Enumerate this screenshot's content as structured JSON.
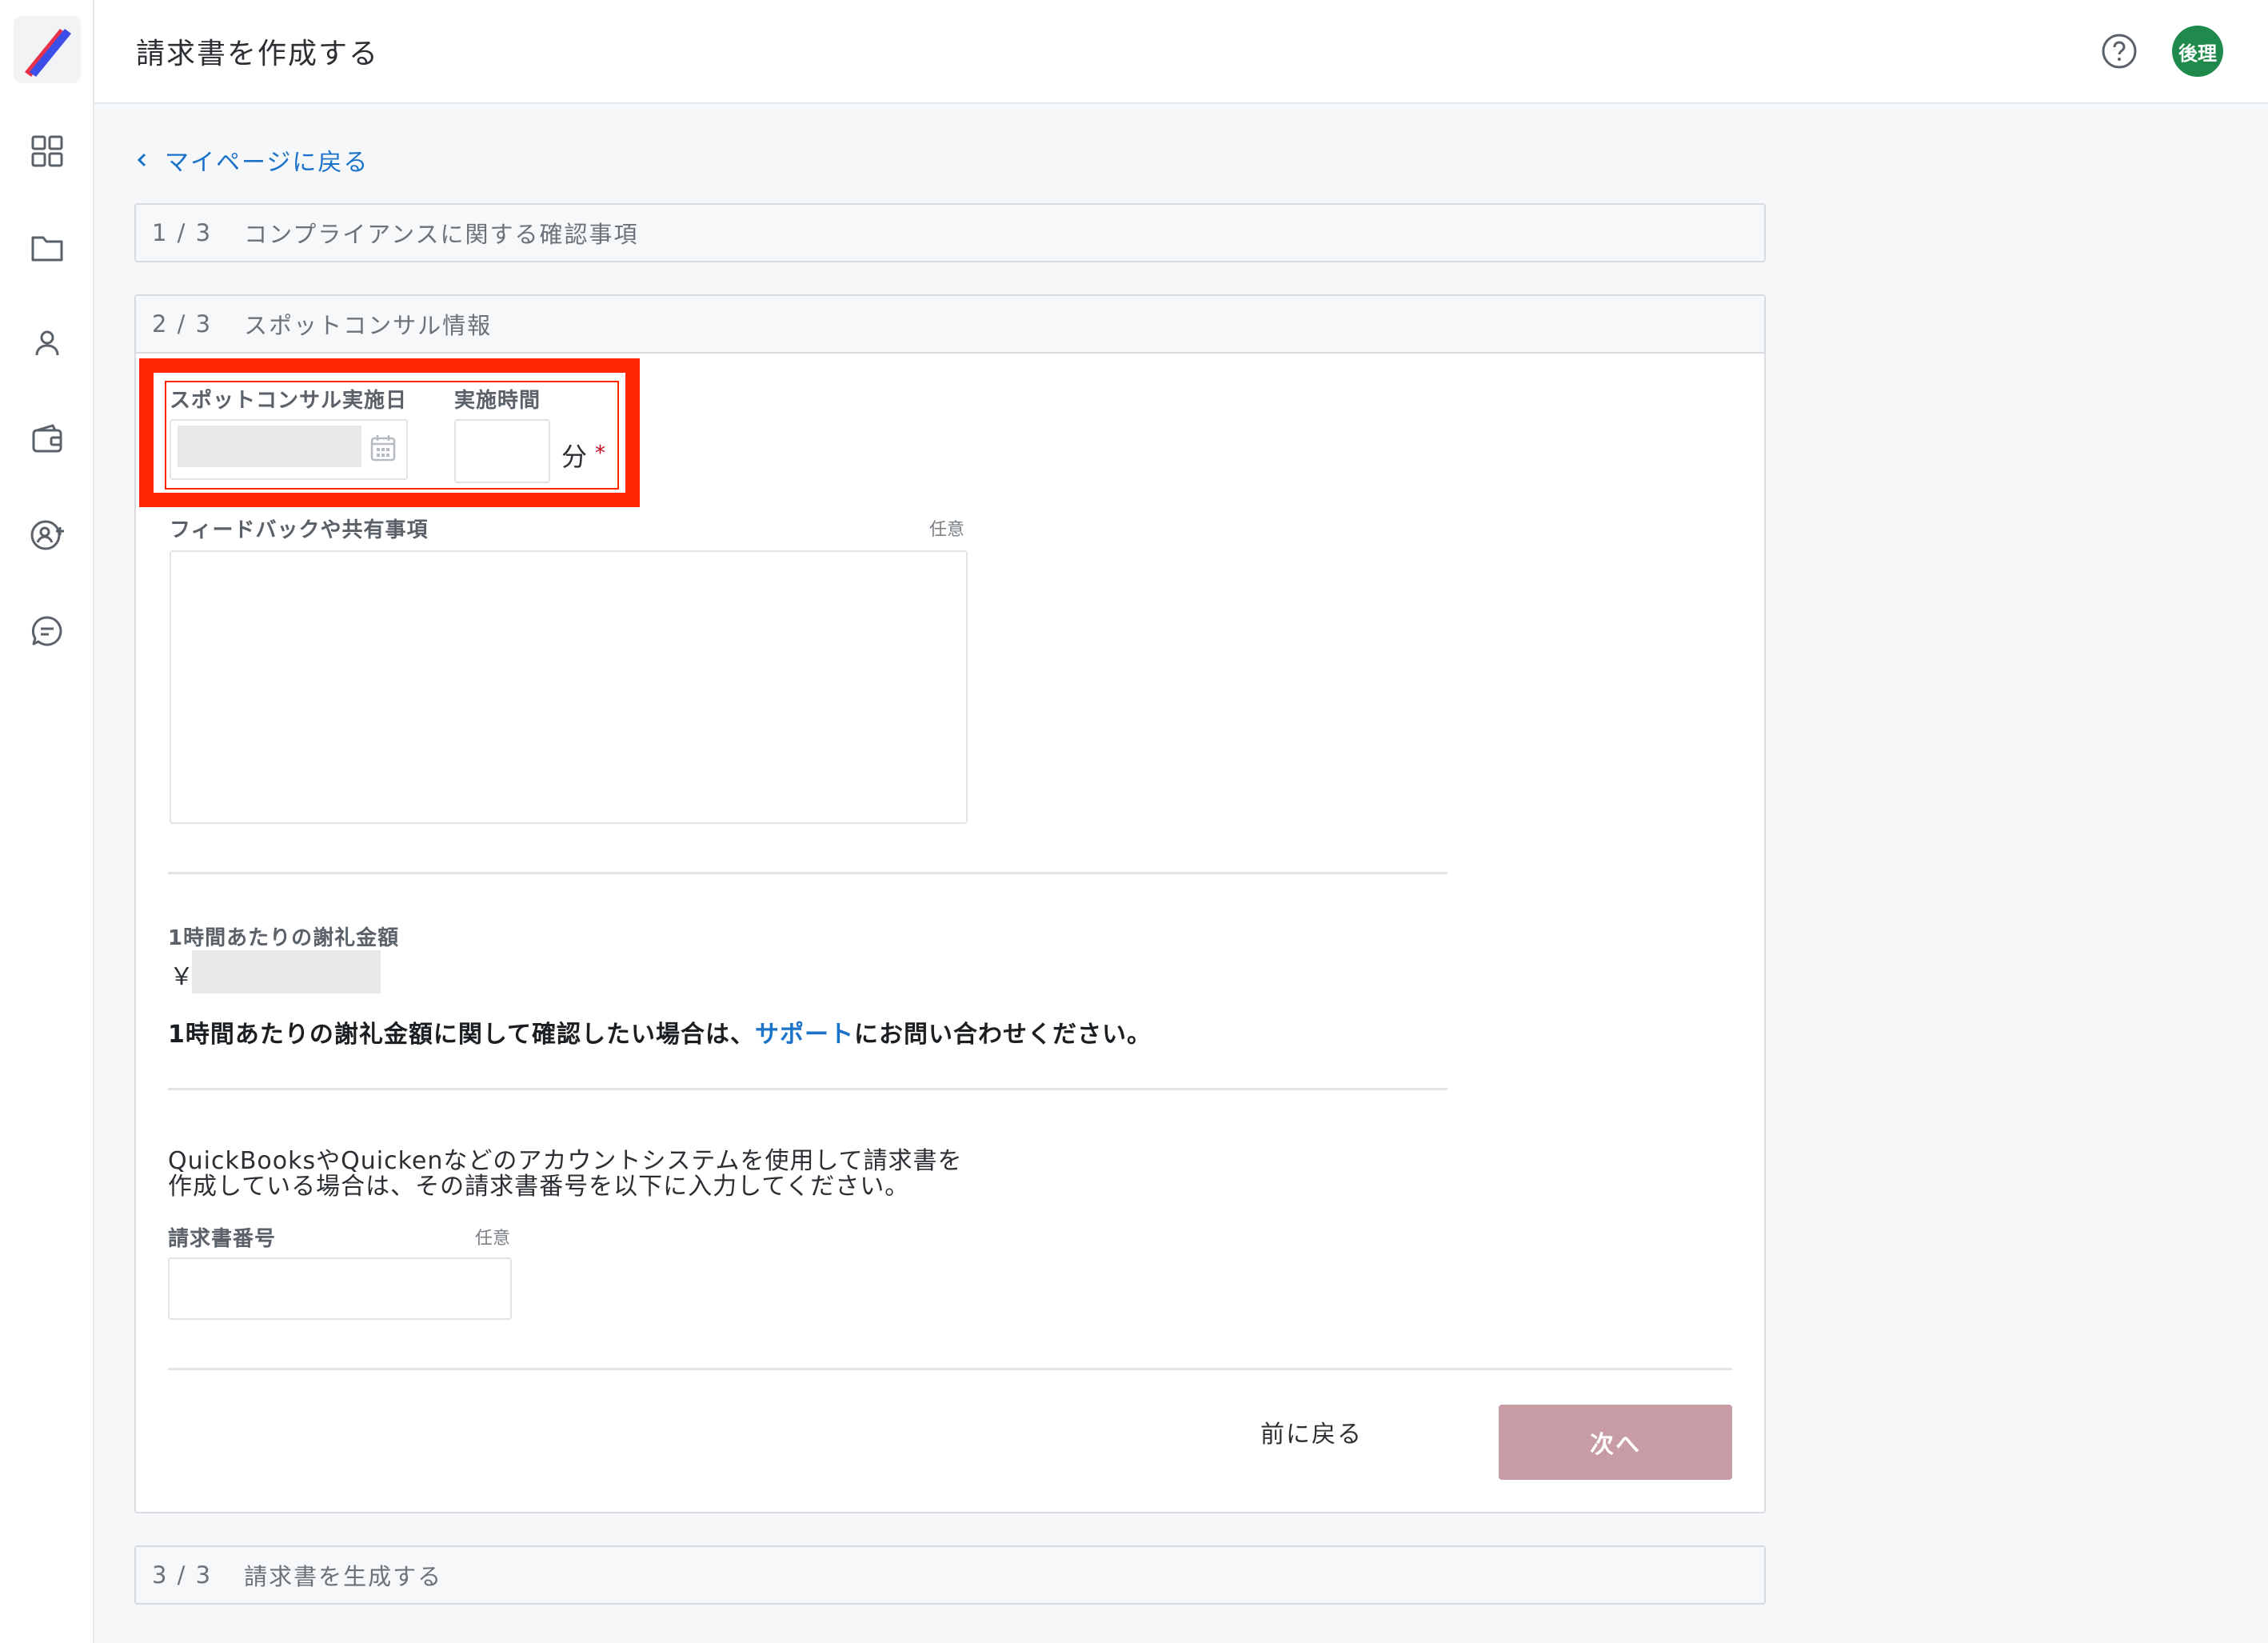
{
  "header": {
    "title": "請求書を作成する",
    "avatar_text": "後理"
  },
  "sidebar": {
    "items": [
      {
        "icon": "grid-icon"
      },
      {
        "icon": "folder-icon"
      },
      {
        "icon": "user-icon"
      },
      {
        "icon": "wallet-icon"
      },
      {
        "icon": "add-user-icon"
      },
      {
        "icon": "chat-icon"
      }
    ]
  },
  "back_link": "マイページに戻る",
  "steps": {
    "step1": {
      "num": "1 / 3",
      "label": "コンプライアンスに関する確認事項"
    },
    "step2": {
      "num": "2 / 3",
      "label": "スポットコンサル情報"
    },
    "step3": {
      "num": "3 / 3",
      "label": "請求書を生成する"
    }
  },
  "form": {
    "date_label": "スポットコンサル実施日",
    "duration_label": "実施時間",
    "duration_unit": "分",
    "required_mark": "*",
    "feedback_label": "フィードバックや共有事項",
    "optional_label": "任意",
    "rate_label": "1時間あたりの謝礼金額",
    "rate_prefix": "￥",
    "rate_note_before": "1時間あたりの謝礼金額に関して確認したい場合は、",
    "rate_note_link": "サポート",
    "rate_note_after": "にお問い合わせください。",
    "accounting_line1": "QuickBooksやQuickenなどのアカウントシステムを使用して請求書を",
    "accounting_line2": "作成している場合は、その請求書番号を以下に入力してください。",
    "invoice_label": "請求書番号",
    "invoice_optional": "任意"
  },
  "buttons": {
    "back": "前に戻る",
    "next": "次へ"
  },
  "colors": {
    "accent": "#1a73c9",
    "highlight": "#ff2600",
    "next_button": "#c89ca4",
    "avatar": "#1f8a4c"
  }
}
